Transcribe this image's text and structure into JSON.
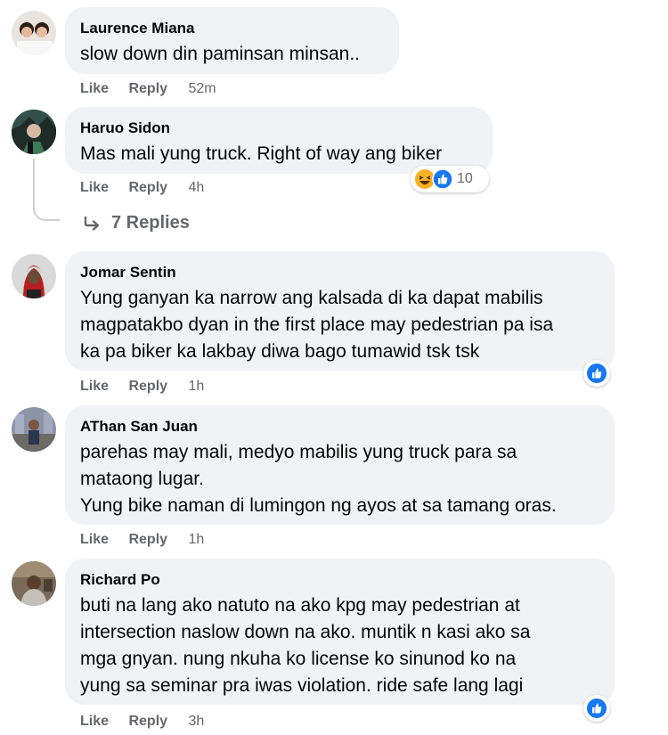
{
  "comments": [
    {
      "author": "Laurence Miana",
      "text_lines": [
        "slow down din paminsan minsan.."
      ],
      "like_label": "Like",
      "reply_label": "Reply",
      "time": "52m"
    },
    {
      "author": "Haruo Sidon",
      "text_lines": [
        "Mas mali yung truck. Right of way ang biker"
      ],
      "like_label": "Like",
      "reply_label": "Reply",
      "time": "4h",
      "reactions": {
        "icons": [
          "haha-icon",
          "like-icon"
        ],
        "count": "10"
      },
      "replies_label": "7 Replies"
    },
    {
      "author": "Jomar Sentin",
      "text_lines": [
        "Yung ganyan ka narrow ang kalsada di ka dapat mabilis",
        "magpatakbo dyan in the first place may pedestrian pa isa",
        "ka pa biker ka lakbay diwa bago tumawid tsk tsk"
      ],
      "like_label": "Like",
      "reply_label": "Reply",
      "time": "1h",
      "reactions": {
        "icons": [
          "like-icon"
        ]
      }
    },
    {
      "author": "AThan San Juan",
      "text_lines": [
        "parehas may mali, medyo mabilis yung truck para sa",
        "mataong lugar.",
        "Yung bike naman di lumingon ng ayos at sa tamang oras."
      ],
      "like_label": "Like",
      "reply_label": "Reply",
      "time": "1h"
    },
    {
      "author": "Richard Po",
      "text_lines": [
        "buti na lang ako natuto na ako kpg may pedestrian at",
        "intersection naslow down na ako. muntik n kasi ako sa",
        "mga gnyan. nung nkuha ko license ko sinunod ko na",
        "yung sa seminar pra iwas violation. ride safe lang lagi"
      ],
      "like_label": "Like",
      "reply_label": "Reply",
      "time": "3h",
      "reactions": {
        "icons": [
          "like-icon"
        ]
      }
    }
  ],
  "colors": {
    "bubble_bg": "#f0f2f5",
    "meta_text": "#65676b",
    "like_blue": "#1877f2",
    "haha_yellow": "#f7b125"
  }
}
